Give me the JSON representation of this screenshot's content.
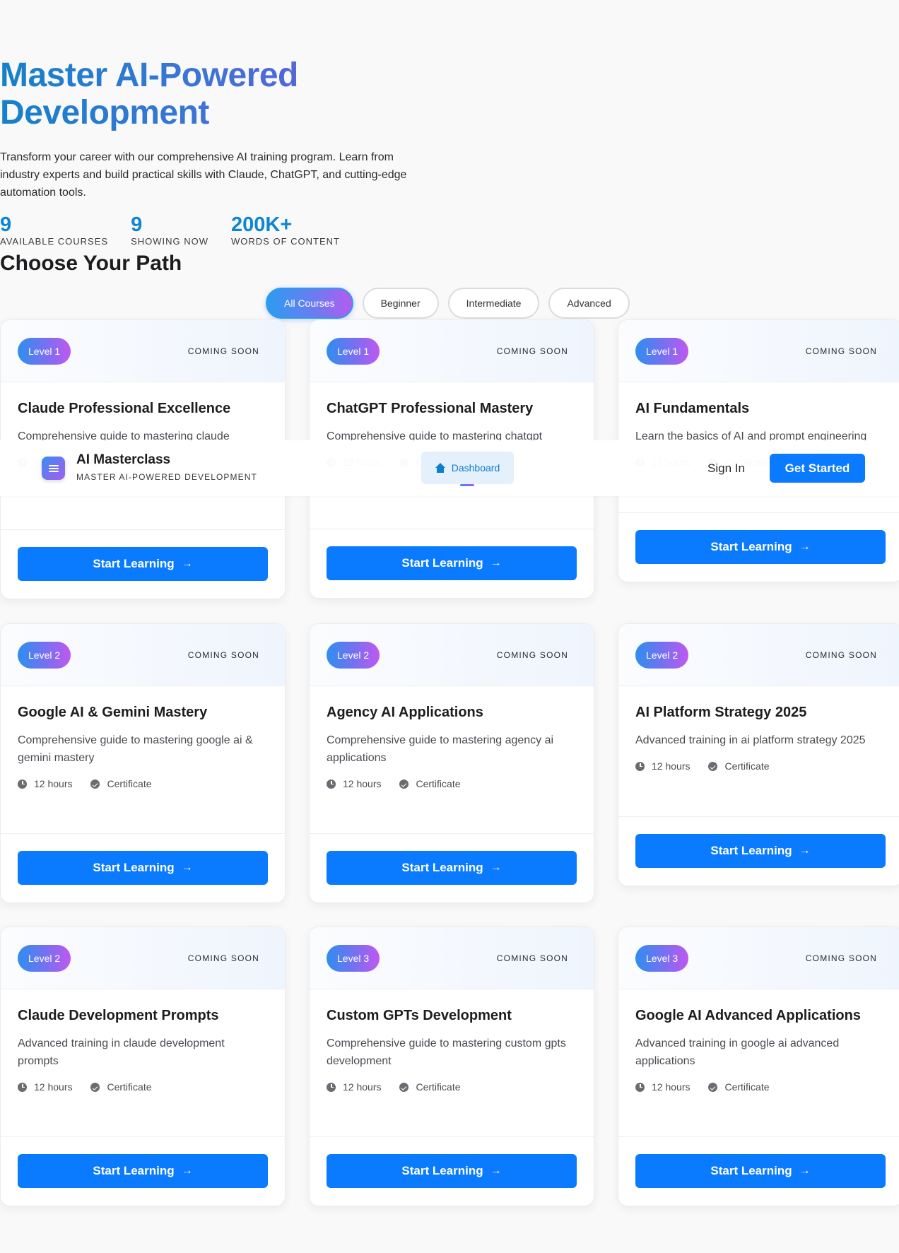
{
  "hero": {
    "title_line1": "Master AI-Powered",
    "title_line2": "Development",
    "description": "Transform your career with our comprehensive AI training program. Learn from industry experts and build practical skills with Claude, ChatGPT, and cutting-edge automation tools."
  },
  "stats": [
    {
      "value": "9",
      "label": "AVAILABLE COURSES"
    },
    {
      "value": "9",
      "label": "SHOWING NOW"
    },
    {
      "value": "200K+",
      "label": "WORDS OF CONTENT"
    }
  ],
  "section_title": "Choose Your Path",
  "filters": [
    "All Courses",
    "Beginner",
    "Intermediate",
    "Advanced"
  ],
  "active_filter": "All Courses",
  "courses": [
    {
      "level": "Level 1",
      "status": "COMING SOON",
      "title": "Claude Professional Excellence",
      "description": "Comprehensive guide to mastering claude",
      "hours": "12 hours",
      "certificate": "Certificate",
      "button": "Start Learning"
    },
    {
      "level": "Level 1",
      "status": "COMING SOON",
      "title": "ChatGPT Professional Mastery",
      "description": "Comprehensive guide to mastering chatgpt",
      "hours": "12 hours",
      "certificate": "Certificate",
      "button": "Start Learning"
    },
    {
      "level": "Level 1",
      "status": "COMING SOON",
      "title": "AI Fundamentals",
      "description": "Learn the basics of AI and prompt engineering",
      "hours": "12 hours",
      "certificate": "Certificate",
      "button": "Start Learning"
    },
    {
      "level": "Level 2",
      "status": "COMING SOON",
      "title": "Google AI & Gemini Mastery",
      "description": "Comprehensive guide to mastering google ai & gemini mastery",
      "hours": "12 hours",
      "certificate": "Certificate",
      "button": "Start Learning"
    },
    {
      "level": "Level 2",
      "status": "COMING SOON",
      "title": "Agency AI Applications",
      "description": "Comprehensive guide to mastering agency ai applications",
      "hours": "12 hours",
      "certificate": "Certificate",
      "button": "Start Learning"
    },
    {
      "level": "Level 2",
      "status": "COMING SOON",
      "title": "AI Platform Strategy 2025",
      "description": "Advanced training in ai platform strategy 2025",
      "hours": "12 hours",
      "certificate": "Certificate",
      "button": "Start Learning"
    },
    {
      "level": "Level 2",
      "status": "COMING SOON",
      "title": "Claude Development Prompts",
      "description": "Advanced training in claude development prompts",
      "hours": "12 hours",
      "certificate": "Certificate",
      "button": "Start Learning"
    },
    {
      "level": "Level 3",
      "status": "COMING SOON",
      "title": "Custom GPTs Development",
      "description": "Comprehensive guide to mastering custom gpts development",
      "hours": "12 hours",
      "certificate": "Certificate",
      "button": "Start Learning"
    },
    {
      "level": "Level 3",
      "status": "COMING SOON",
      "title": "Google AI Advanced Applications",
      "description": "Advanced training in google ai advanced applications",
      "hours": "12 hours",
      "certificate": "Certificate",
      "button": "Start Learning"
    }
  ],
  "navbar": {
    "brand": "AI Masterclass",
    "tagline": "MASTER AI-POWERED DEVELOPMENT",
    "dashboard": "Dashboard",
    "sign_in": "Sign In",
    "get_started": "Get Started"
  },
  "icons": {
    "logo": "menu-icon",
    "dashboard": "home-icon",
    "hours": "clock-icon",
    "certificate": "check-circle-icon",
    "button_arrow": "arrow-right-icon"
  },
  "colors": {
    "primary": "#0a7aff",
    "accent_gradient_start": "#2e8ef0",
    "accent_gradient_end": "#c058f0",
    "stat_value": "#0e86d4"
  }
}
